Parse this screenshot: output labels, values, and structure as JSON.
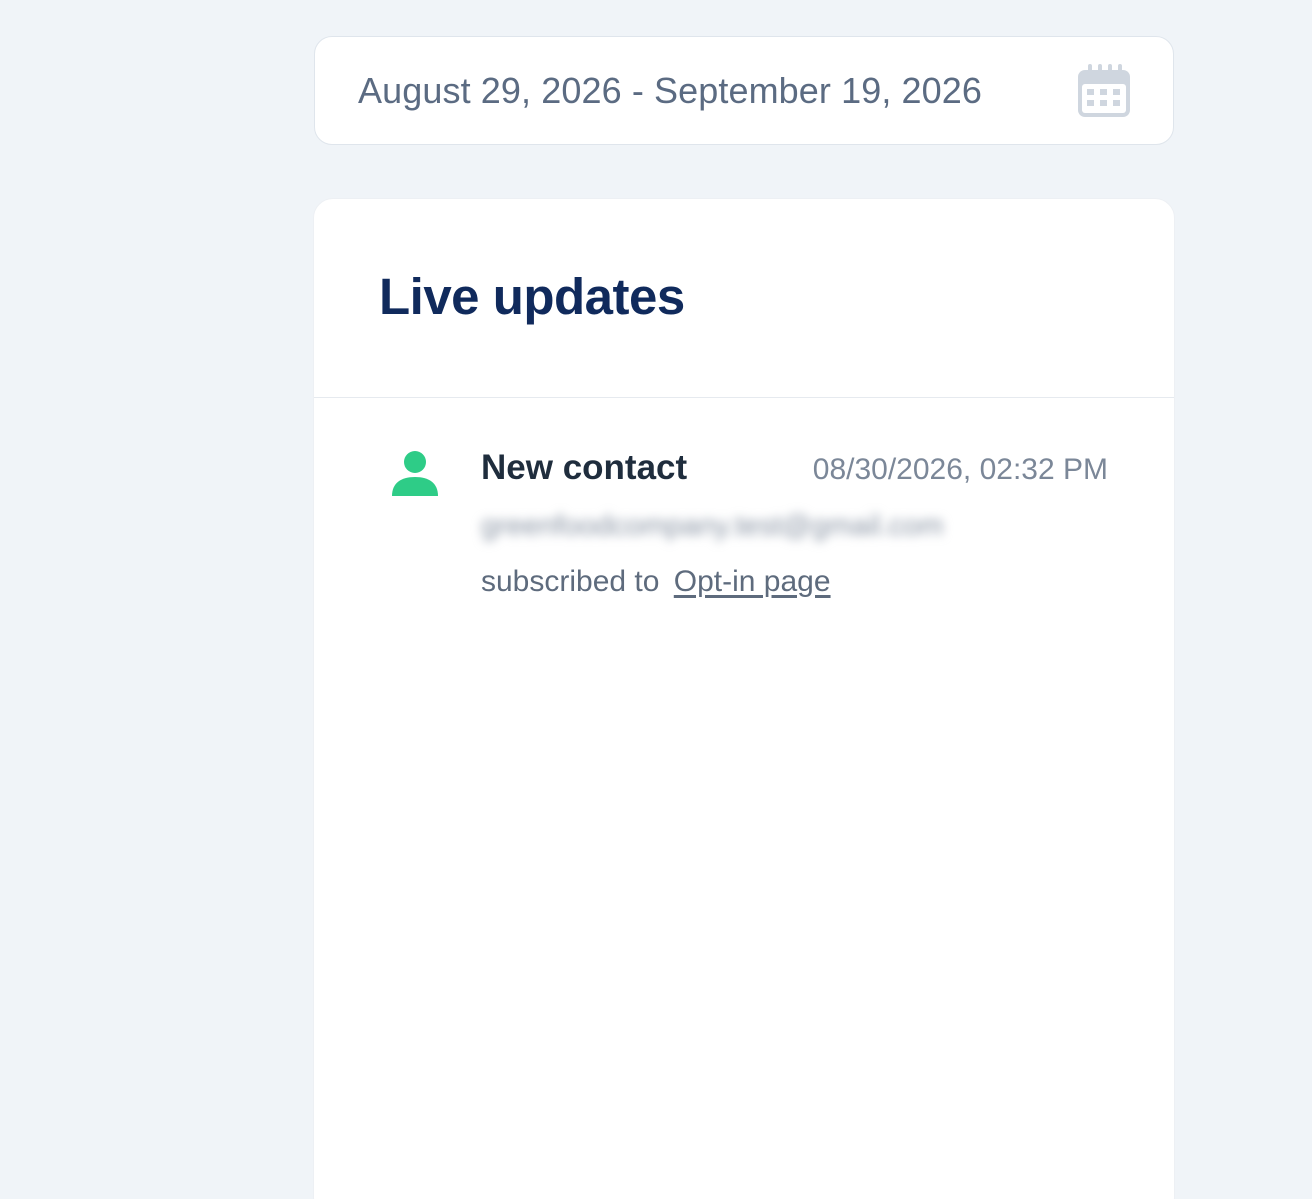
{
  "date_range": {
    "label": "August 29, 2026 - September 19, 2026",
    "icon": "calendar-icon"
  },
  "live_updates": {
    "title": "Live updates",
    "items": [
      {
        "icon": "person-icon",
        "icon_color": "#2ecc87",
        "title": "New contact",
        "timestamp": "08/30/2026, 02:32 PM",
        "email": "greenfoodcompany.test@gmail.com",
        "description_prefix": "subscribed to",
        "link_label": "Opt-in page"
      }
    ]
  },
  "colors": {
    "background": "#f0f4f8",
    "title": "#102a5c",
    "accent_green": "#2ecc87",
    "muted_text": "#5b6b82"
  }
}
